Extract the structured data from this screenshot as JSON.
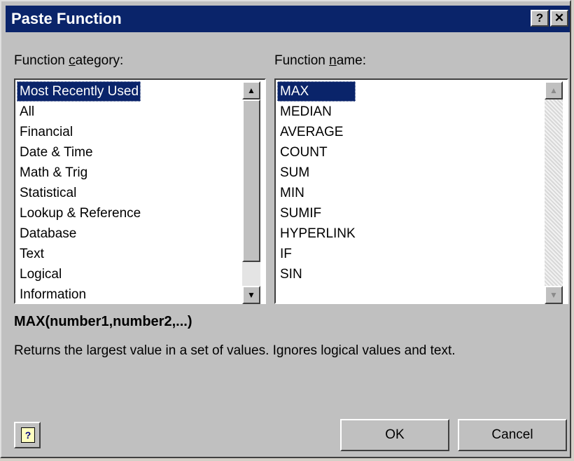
{
  "dialog": {
    "title": "Paste Function",
    "help_button": "?",
    "close_button": "✕"
  },
  "category": {
    "label_prefix": "Function ",
    "label_accel": "c",
    "label_suffix": "ategory:",
    "items": [
      "Most Recently Used",
      "All",
      "Financial",
      "Date & Time",
      "Math & Trig",
      "Statistical",
      "Lookup & Reference",
      "Database",
      "Text",
      "Logical",
      "Information"
    ],
    "selected": "Most Recently Used"
  },
  "function_name": {
    "label_prefix": "Function ",
    "label_accel": "n",
    "label_suffix": "ame:",
    "items": [
      "MAX",
      "MEDIAN",
      "AVERAGE",
      "COUNT",
      "SUM",
      "MIN",
      "SUMIF",
      "HYPERLINK",
      "IF",
      "SIN"
    ],
    "selected": "MAX"
  },
  "syntax": "MAX(number1,number2,...)",
  "description": "Returns the largest value in a set of values. Ignores logical values and text.",
  "buttons": {
    "ok": "OK",
    "cancel": "Cancel",
    "office_help_icon": "?"
  },
  "icons": {
    "scroll_up": "▲",
    "scroll_down": "▼"
  },
  "colors": {
    "title_bar": "#0a246a",
    "selection": "#0a246a",
    "face": "#c0c0c0"
  }
}
